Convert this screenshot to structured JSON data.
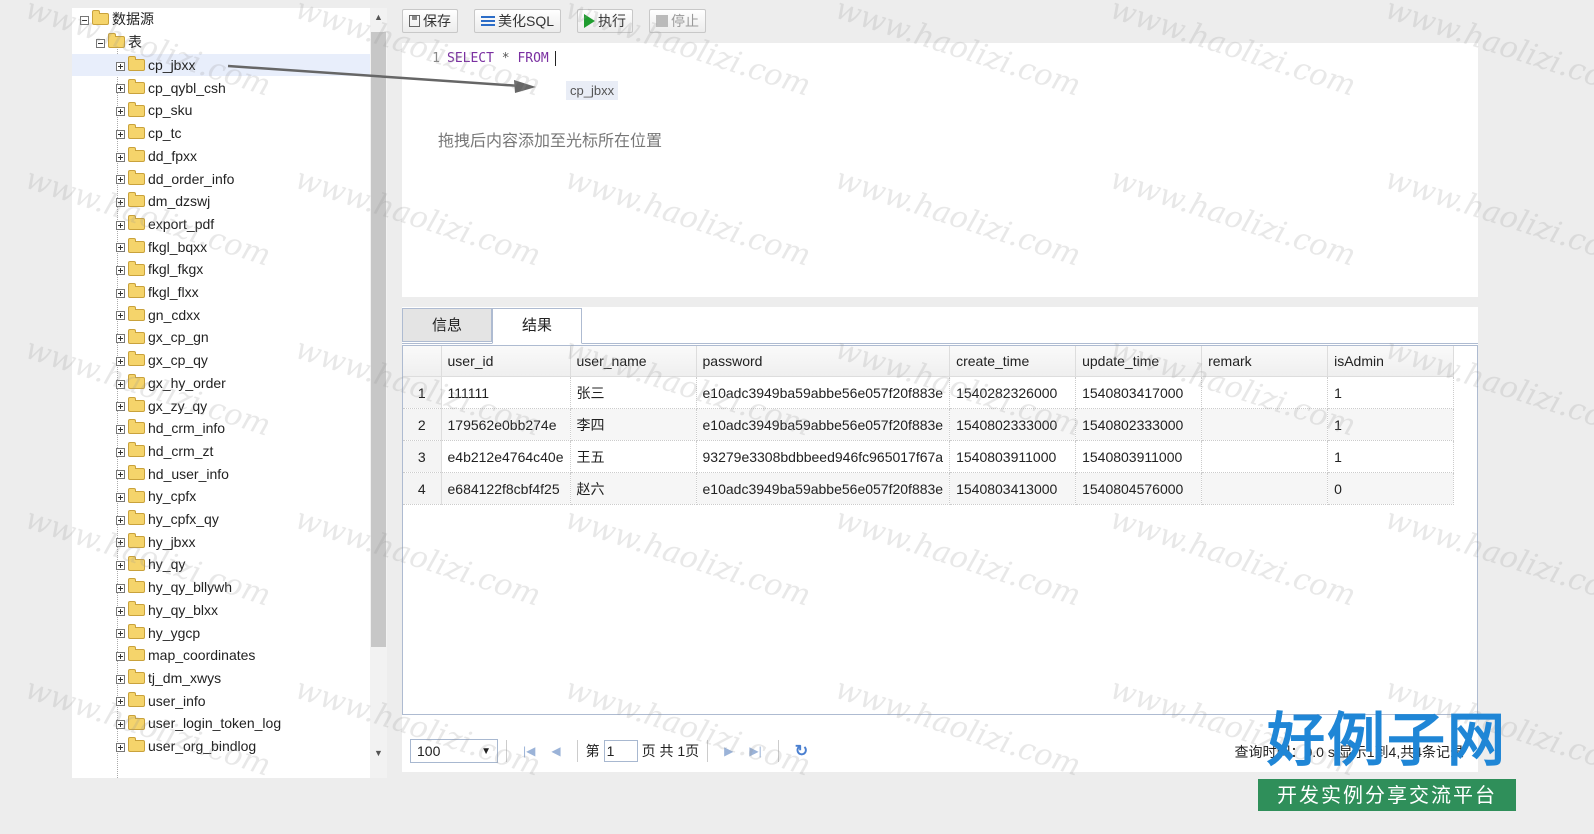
{
  "tree": {
    "root_label": "数据源",
    "group_label": "表",
    "tables": [
      "cp_jbxx",
      "cp_qybl_csh",
      "cp_sku",
      "cp_tc",
      "dd_fpxx",
      "dd_order_info",
      "dm_dzswj",
      "export_pdf",
      "fkgl_bqxx",
      "fkgl_fkgx",
      "fkgl_flxx",
      "gn_cdxx",
      "gx_cp_gn",
      "gx_cp_qy",
      "gx_hy_order",
      "gx_zy_qy",
      "hd_crm_info",
      "hd_crm_zt",
      "hd_user_info",
      "hy_cpfx",
      "hy_cpfx_qy",
      "hy_jbxx",
      "hy_qy",
      "hy_qy_bllywh",
      "hy_qy_blxx",
      "hy_ygcp",
      "map_coordinates",
      "tj_dm_xwys",
      "user_info",
      "user_login_token_log",
      "user_org_bindlog"
    ],
    "selected": "cp_jbxx"
  },
  "toolbar": {
    "save_label": "保存",
    "beautify_label": "美化SQL",
    "run_label": "执行",
    "stop_label": "停止"
  },
  "editor": {
    "line_number": "1",
    "kw_select": "SELECT",
    "star": "*",
    "kw_from": "FROM",
    "drag_text": "cp_jbxx",
    "hint": "拖拽后内容添加至光标所在位置"
  },
  "tabs": {
    "info": "信息",
    "result": "结果"
  },
  "grid": {
    "columns": [
      "user_id",
      "user_name",
      "password",
      "create_time",
      "update_time",
      "remark",
      "isAdmin"
    ],
    "rows": [
      {
        "n": "1",
        "user_id": "111111",
        "user_name": "张三",
        "password": "e10adc3949ba59abbe56e057f20f883e",
        "create_time": "1540282326000",
        "update_time": "1540803417000",
        "remark": "",
        "isAdmin": "1"
      },
      {
        "n": "2",
        "user_id": "179562e0bb274e",
        "user_name": "李四",
        "password": "e10adc3949ba59abbe56e057f20f883e",
        "create_time": "1540802333000",
        "update_time": "1540802333000",
        "remark": "",
        "isAdmin": "1"
      },
      {
        "n": "3",
        "user_id": "e4b212e4764c40e",
        "user_name": "王五",
        "password": "93279e3308bdbbeed946fc965017f67a",
        "create_time": "1540803911000",
        "update_time": "1540803911000",
        "remark": "",
        "isAdmin": "1"
      },
      {
        "n": "4",
        "user_id": "e684122f8cbf4f25",
        "user_name": "赵六",
        "password": "e10adc3949ba59abbe56e057f20f883e",
        "create_time": "1540803413000",
        "update_time": "1540804576000",
        "remark": "",
        "isAdmin": "0"
      }
    ]
  },
  "pager": {
    "page_size": "100",
    "page_prefix": "第",
    "page_value": "1",
    "page_suffix": "页 共 1页",
    "status": "查询时间：0.0 s   显示1到4,共4条记录"
  },
  "watermark": "www.haolizi.com",
  "logo": {
    "main": "好例子网",
    "sub": "开发实例分享交流平台"
  }
}
